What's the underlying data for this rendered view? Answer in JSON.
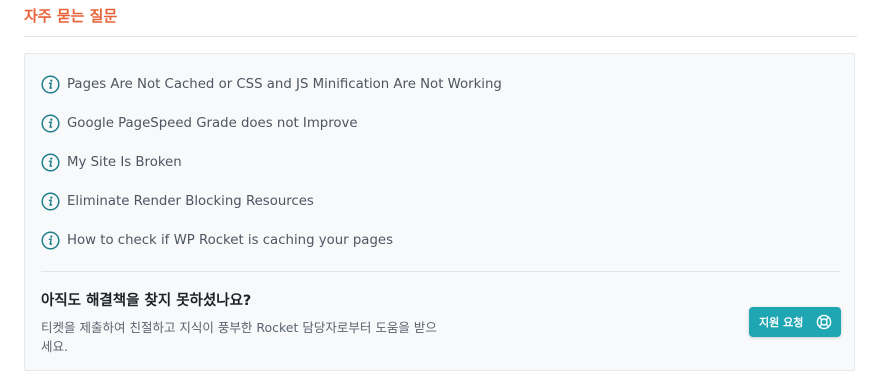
{
  "section": {
    "title": "자주 묻는 질문"
  },
  "faq": {
    "items": [
      {
        "label": "Pages Are Not Cached or CSS and JS Minification Are Not Working",
        "icon": "info-icon"
      },
      {
        "label": "Google PageSpeed Grade does not Improve",
        "icon": "info-icon"
      },
      {
        "label": "My Site Is Broken",
        "icon": "info-icon"
      },
      {
        "label": "Eliminate Render Blocking Resources",
        "icon": "info-icon"
      },
      {
        "label": "How to check if WP Rocket is caching your pages",
        "icon": "info-icon"
      }
    ]
  },
  "help": {
    "heading": "아직도 해결책을 찾지 못하셨나요?",
    "text": "티켓을 제출하여 친절하고 지식이 풍부한 Rocket 담당자로부터 도움을 받으세요.",
    "button_label": "지원 요청",
    "button_icon": "lifebuoy-icon"
  },
  "colors": {
    "title_accent": "#e8633a",
    "icon_teal": "#1e7f8a",
    "button_bg": "#1ea6b3"
  }
}
